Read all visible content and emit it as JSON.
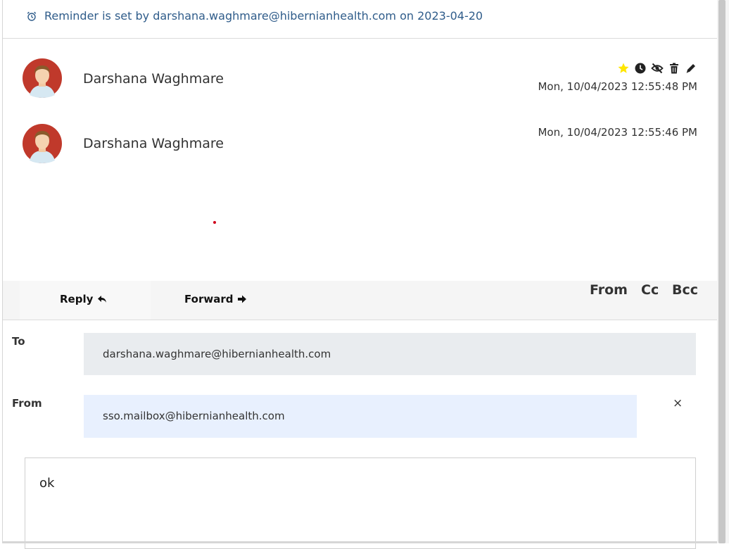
{
  "reminder": {
    "icon": "alarm-clock-icon",
    "text": "Reminder is set by darshana.waghmare@hibernianhealth.com on 2023-04-20"
  },
  "messages": [
    {
      "sender": "Darshana Waghmare",
      "timestamp": "Mon, 10/04/2023 12:55:48 PM"
    },
    {
      "sender": "Darshana Waghmare",
      "timestamp": "Mon, 10/04/2023 12:55:46 PM"
    }
  ],
  "actions": {
    "icons": [
      "star-icon",
      "clock-icon",
      "eye-slash-icon",
      "trash-icon",
      "edit-icon"
    ],
    "star_color": "#ffe600"
  },
  "toolbar": {
    "reply_label": "Reply",
    "forward_label": "Forward",
    "from_toggle": "From",
    "cc_toggle": "Cc",
    "bcc_toggle": "Bcc"
  },
  "form": {
    "to_label": "To",
    "to_value": "darshana.waghmare@hibernianhealth.com",
    "from_label": "From",
    "from_value": "sso.mailbox@hibernianhealth.com",
    "remove_from_symbol": "×",
    "body_text": "ok"
  },
  "colors": {
    "link_blue": "#2f5c8a",
    "to_field_bg": "#e9ecef",
    "from_field_bg": "#e8f0fe"
  }
}
